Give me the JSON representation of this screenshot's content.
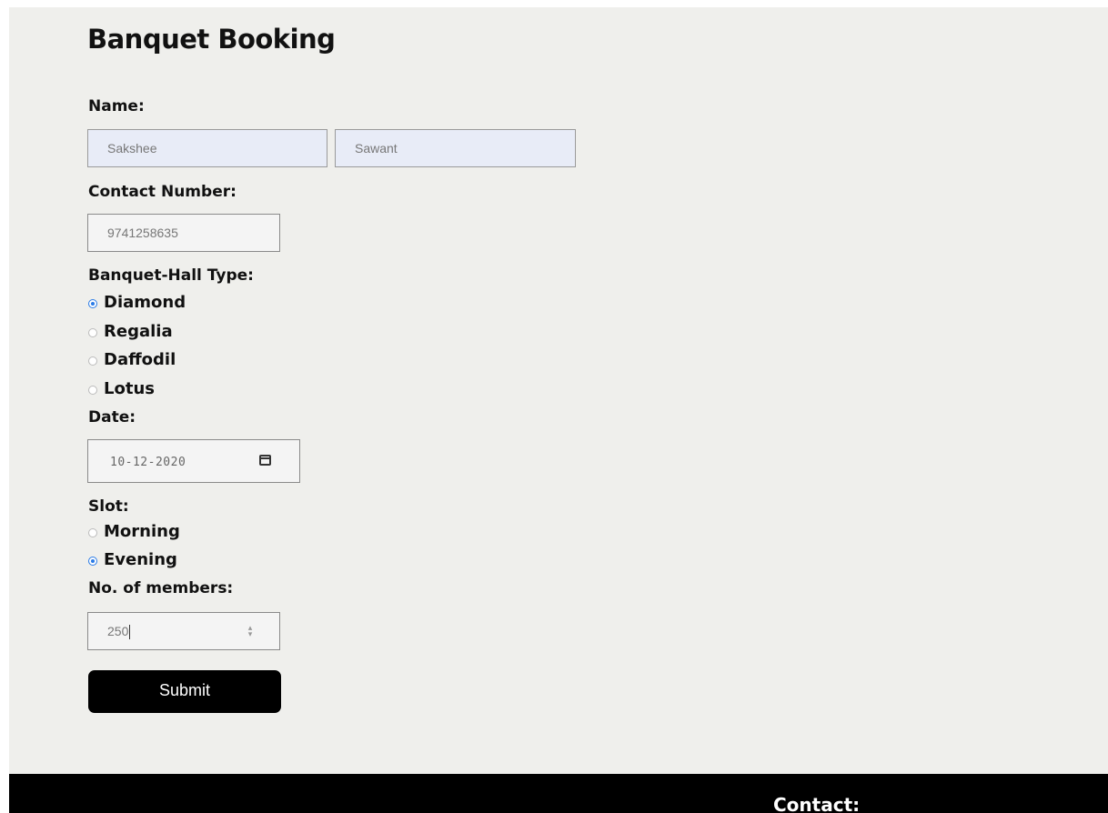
{
  "form": {
    "title": "Banquet Booking",
    "name_label": "Name:",
    "first_name": "Sakshee",
    "last_name": "Sawant",
    "contact_label": "Contact Number:",
    "contact_value": "9741258635",
    "hall_label": "Banquet-Hall Type:",
    "hall_options": [
      {
        "label": "Diamond",
        "checked": true
      },
      {
        "label": "Regalia",
        "checked": false
      },
      {
        "label": "Daffodil",
        "checked": false
      },
      {
        "label": "Lotus",
        "checked": false
      }
    ],
    "date_label": "Date:",
    "date_value": "10-12-2020",
    "slot_label": "Slot:",
    "slot_options": [
      {
        "label": "Morning",
        "checked": false
      },
      {
        "label": "Evening",
        "checked": true
      }
    ],
    "members_label": "No. of members:",
    "members_value": "250",
    "submit_label": "Submit"
  },
  "footer": {
    "contact_heading": "Contact:"
  },
  "colors": {
    "radio_accent": "#2a7be6",
    "page_background": "#efefec",
    "footer_background": "#000000"
  },
  "icons": {
    "date_picker": "calendar-icon",
    "number_spinner": "spinner-icon"
  }
}
